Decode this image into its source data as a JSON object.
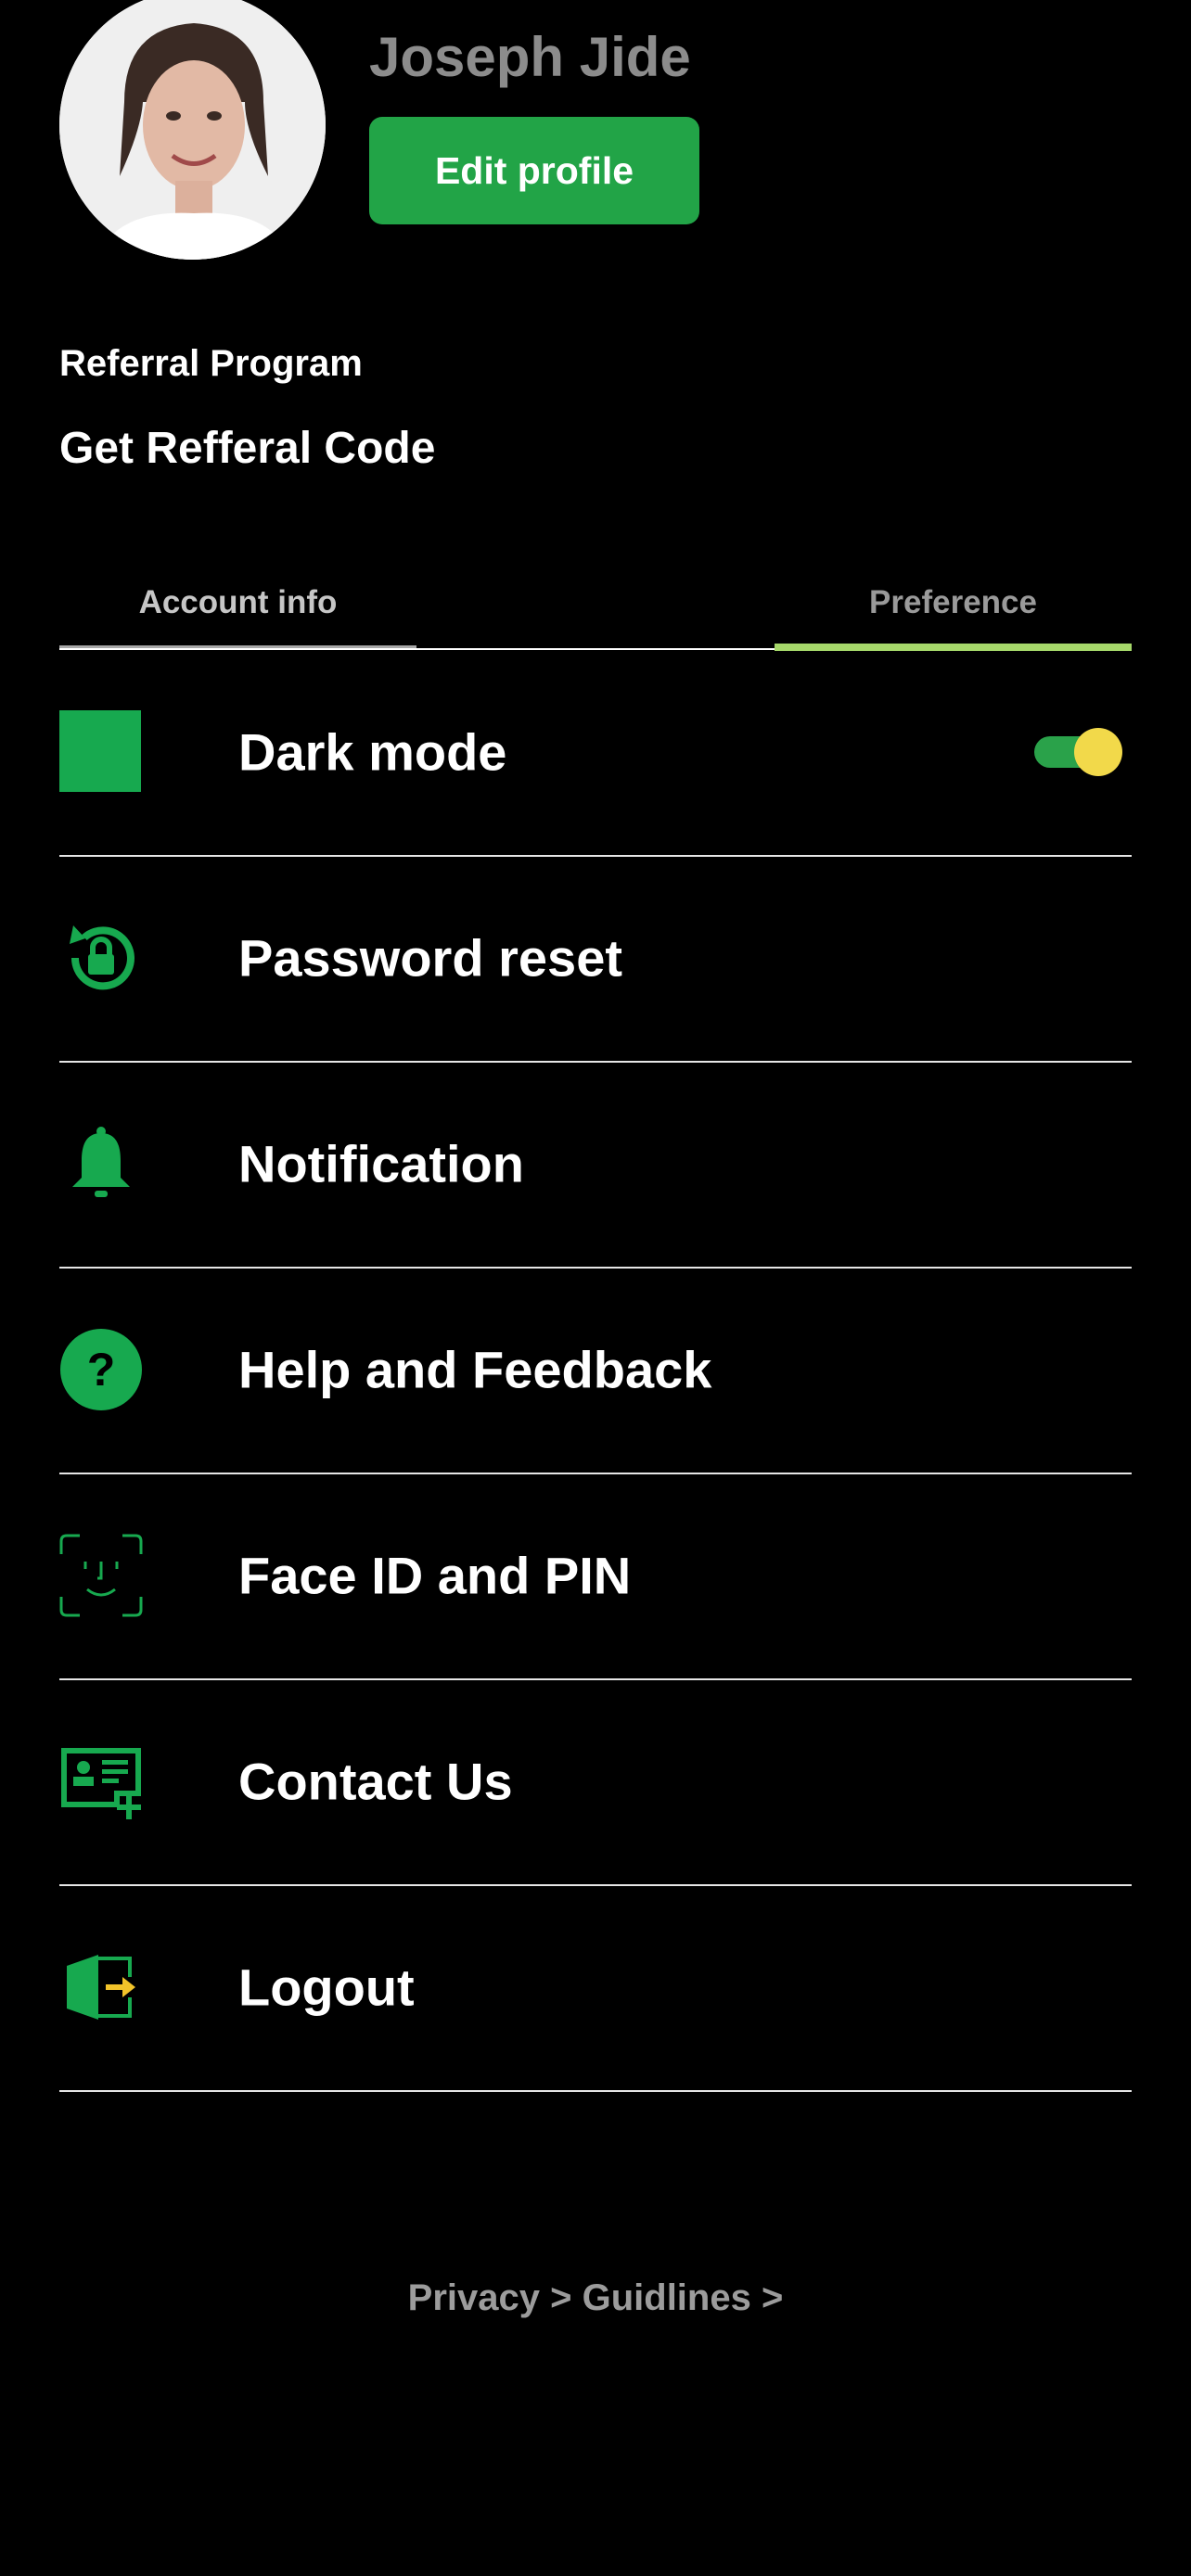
{
  "profile": {
    "name": "Joseph Jide",
    "edit_button": "Edit profile"
  },
  "referral": {
    "title": "Referral Program",
    "code_link": "Get Refferal Code"
  },
  "tabs": [
    {
      "label": "Account info"
    },
    {
      "label": "Preference",
      "active": true
    }
  ],
  "settings": {
    "items": [
      {
        "label": "Dark mode",
        "icon": "square-icon",
        "toggle": true
      },
      {
        "label": "Password reset",
        "icon": "lock-reset-icon"
      },
      {
        "label": "Notification",
        "icon": "bell-icon"
      },
      {
        "label": "Help and Feedback",
        "icon": "help-icon"
      },
      {
        "label": "Face ID and PIN",
        "icon": "face-id-icon"
      },
      {
        "label": "Contact Us",
        "icon": "contact-card-icon"
      },
      {
        "label": "Logout",
        "icon": "logout-icon"
      }
    ]
  },
  "footer": {
    "links": "Privacy > Guidlines >"
  },
  "colors": {
    "background": "#000000",
    "accent_green": "#22a447",
    "toggle_knob": "#f2d94a",
    "tab_active_underline": "#a6d86a"
  }
}
